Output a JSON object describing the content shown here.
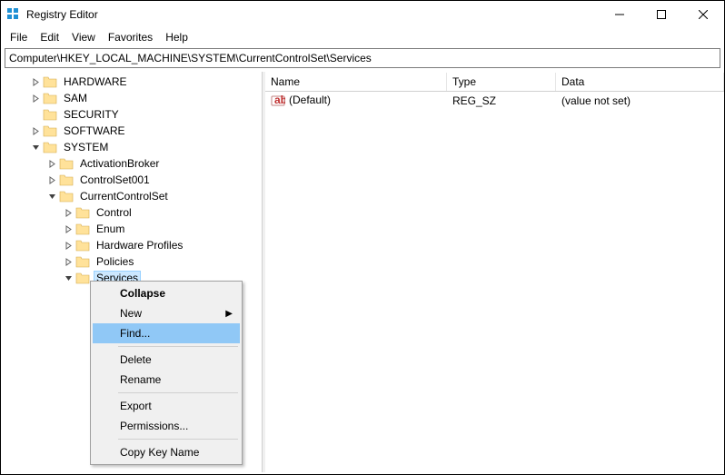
{
  "window": {
    "title": "Registry Editor"
  },
  "menubar": [
    "File",
    "Edit",
    "View",
    "Favorites",
    "Help"
  ],
  "address": "Computer\\HKEY_LOCAL_MACHINE\\SYSTEM\\CurrentControlSet\\Services",
  "tree": [
    {
      "indent": 1,
      "toggle": ">",
      "label": "HARDWARE"
    },
    {
      "indent": 1,
      "toggle": ">",
      "label": "SAM"
    },
    {
      "indent": 1,
      "toggle": "",
      "label": "SECURITY"
    },
    {
      "indent": 1,
      "toggle": ">",
      "label": "SOFTWARE"
    },
    {
      "indent": 1,
      "toggle": "v",
      "label": "SYSTEM"
    },
    {
      "indent": 2,
      "toggle": ">",
      "label": "ActivationBroker"
    },
    {
      "indent": 2,
      "toggle": ">",
      "label": "ControlSet001"
    },
    {
      "indent": 2,
      "toggle": "v",
      "label": "CurrentControlSet"
    },
    {
      "indent": 3,
      "toggle": ">",
      "label": "Control"
    },
    {
      "indent": 3,
      "toggle": ">",
      "label": "Enum"
    },
    {
      "indent": 3,
      "toggle": ">",
      "label": "Hardware Profiles"
    },
    {
      "indent": 3,
      "toggle": ">",
      "label": "Policies"
    },
    {
      "indent": 3,
      "toggle": "v",
      "label": "Services",
      "selected": true
    }
  ],
  "list": {
    "columns": {
      "name": "Name",
      "type": "Type",
      "data": "Data"
    },
    "rows": [
      {
        "name": "(Default)",
        "type": "REG_SZ",
        "data": "(value not set)"
      }
    ]
  },
  "context_menu": {
    "collapse": "Collapse",
    "new": "New",
    "find": "Find...",
    "delete": "Delete",
    "rename": "Rename",
    "export": "Export",
    "permissions": "Permissions...",
    "copy_key_name": "Copy Key Name"
  }
}
